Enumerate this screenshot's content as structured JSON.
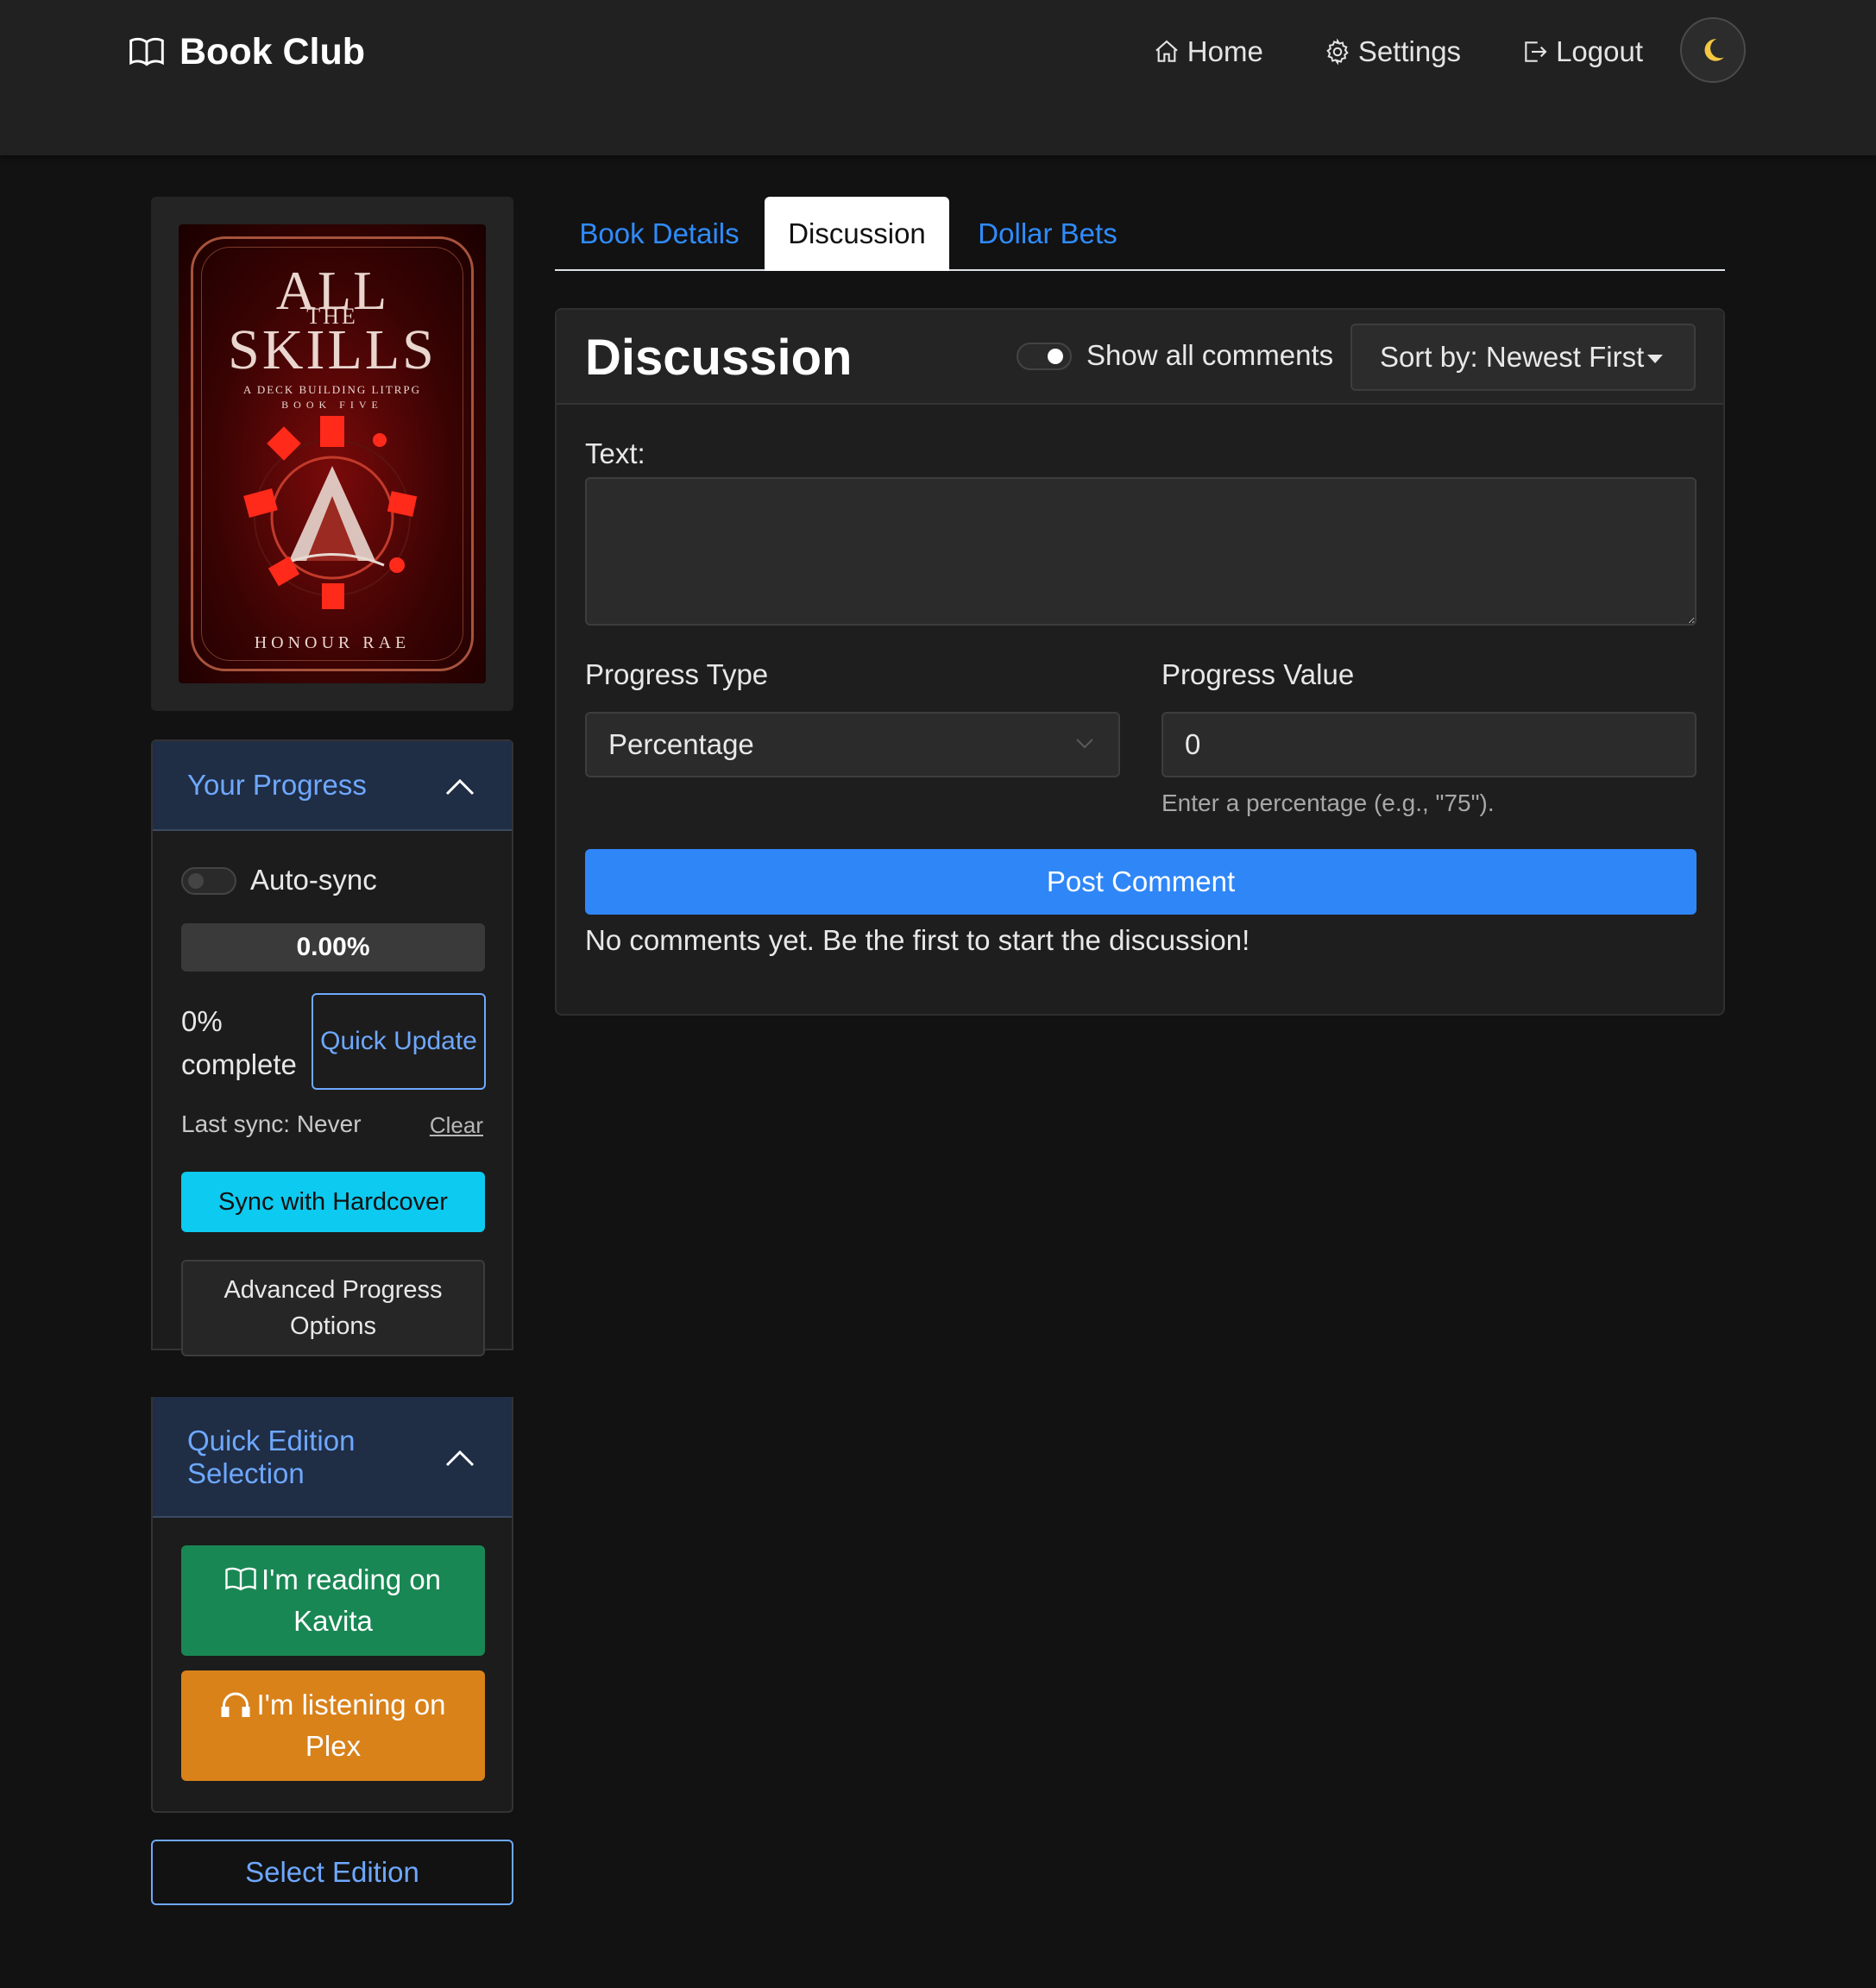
{
  "navbar": {
    "brand": "Book Club",
    "brand_icon": "book-open-icon",
    "links": [
      {
        "label": "Home",
        "icon": "home-icon"
      },
      {
        "label": "Settings",
        "icon": "gear-icon"
      },
      {
        "label": "Logout",
        "icon": "logout-icon"
      }
    ],
    "theme_toggle_icon": "moon-icon"
  },
  "book": {
    "cover": {
      "title_line1": "ALL",
      "title_line2": "THE",
      "title_line3": "SKILLS",
      "subtitle": "A DECK BUILDING LITRPG",
      "series": "BOOK FIVE",
      "author": "HONOUR RAE"
    }
  },
  "progress_panel": {
    "title": "Your Progress",
    "auto_sync_label": "Auto-sync",
    "auto_sync_on": false,
    "progress_fraction": 0.0,
    "progress_text": "0.00%",
    "complete_text": "0% complete",
    "quick_update_label": "Quick Update",
    "last_sync": "Last sync: Never",
    "clear_label": "Clear",
    "sync_button": "Sync with Hardcover",
    "advanced_button": "Advanced Progress Options"
  },
  "edition_panel": {
    "title": "Quick Edition Selection",
    "kavita_button": "I'm reading on Kavita",
    "plex_button": "I'm listening on Plex"
  },
  "select_edition_button": "Select Edition",
  "tabs": [
    {
      "label": "Book Details",
      "active": false
    },
    {
      "label": "Discussion",
      "active": true
    },
    {
      "label": "Dollar Bets",
      "active": false
    }
  ],
  "discussion": {
    "title": "Discussion",
    "show_all_label": "Show all comments",
    "show_all_on": true,
    "sort_label": "Sort by: Newest First",
    "text_label": "Text:",
    "text_value": "",
    "progress_type_label": "Progress Type",
    "progress_type_value": "Percentage",
    "progress_value_label": "Progress Value",
    "progress_value": "0",
    "progress_hint": "Enter a percentage (e.g., \"75\").",
    "post_button": "Post Comment",
    "empty_message": "No comments yet. Be the first to start the discussion!"
  },
  "colors": {
    "accent_blue": "#2f86f7",
    "link_blue": "#6ea8fe",
    "sync_cyan": "#0dcaf0",
    "kavita_green": "#198754",
    "plex_orange": "#d9821a",
    "moon_yellow": "#f5c842"
  }
}
